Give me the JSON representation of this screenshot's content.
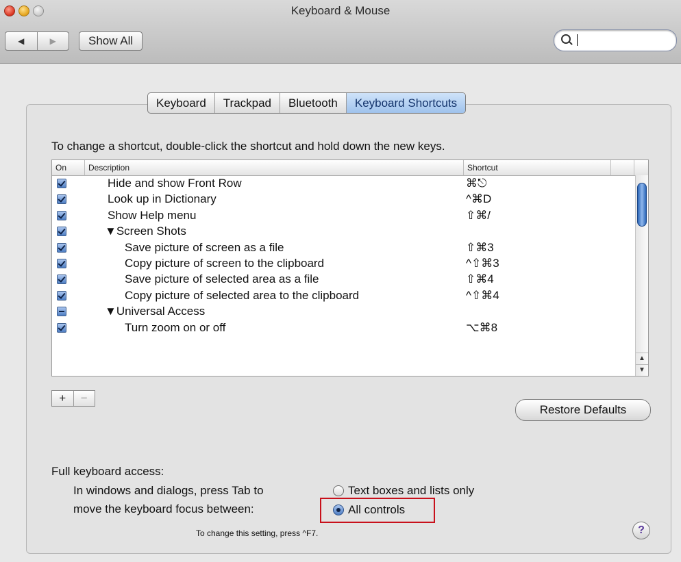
{
  "window": {
    "title": "Keyboard & Mouse"
  },
  "toolbar": {
    "back_glyph": "◀",
    "forward_glyph": "▶",
    "show_all_label": "Show All",
    "search_value": ""
  },
  "tabs": [
    {
      "label": "Keyboard",
      "active": false
    },
    {
      "label": "Trackpad",
      "active": false
    },
    {
      "label": "Bluetooth",
      "active": false
    },
    {
      "label": "Keyboard Shortcuts",
      "active": true
    }
  ],
  "instructions": "To change a shortcut, double-click the shortcut and hold down the new keys.",
  "table": {
    "headers": {
      "on": "On",
      "description": "Description",
      "shortcut": "Shortcut"
    },
    "rows": [
      {
        "checked": "on",
        "indent": 1,
        "description": "Hide and show Front Row",
        "shortcut": "⌘⎋"
      },
      {
        "checked": "on",
        "indent": 1,
        "description": "Look up in Dictionary",
        "shortcut": "^⌘D"
      },
      {
        "checked": "on",
        "indent": 1,
        "description": "Show Help menu",
        "shortcut": "⇧⌘/"
      },
      {
        "checked": "on",
        "indent": 0,
        "description": "▼Screen Shots",
        "shortcut": ""
      },
      {
        "checked": "on",
        "indent": 2,
        "description": "Save picture of screen as a file",
        "shortcut": "⇧⌘3"
      },
      {
        "checked": "on",
        "indent": 2,
        "description": "Copy picture of screen to the clipboard",
        "shortcut": "^⇧⌘3"
      },
      {
        "checked": "on",
        "indent": 2,
        "description": "Save picture of selected area as a file",
        "shortcut": "⇧⌘4"
      },
      {
        "checked": "on",
        "indent": 2,
        "description": "Copy picture of selected area to the clipboard",
        "shortcut": "^⇧⌘4"
      },
      {
        "checked": "mixed",
        "indent": 0,
        "description": "▼Universal Access",
        "shortcut": ""
      },
      {
        "checked": "on",
        "indent": 2,
        "description": "Turn zoom on or off",
        "shortcut": "⌥⌘8"
      }
    ]
  },
  "buttons": {
    "add": "+",
    "remove": "−",
    "restore_defaults": "Restore Defaults",
    "help": "?"
  },
  "keyboard_access": {
    "label": "Full keyboard access:",
    "line1": "In windows and dialogs, press Tab to",
    "line2": "move the keyboard focus between:",
    "option_text_boxes": "Text boxes and lists only",
    "option_all_controls": "All controls",
    "selected": "All controls",
    "hint": "To change this setting, press ^F7."
  },
  "colors": {
    "highlight_box": "#c8101b",
    "selected_tab": "#9fc2ec"
  }
}
